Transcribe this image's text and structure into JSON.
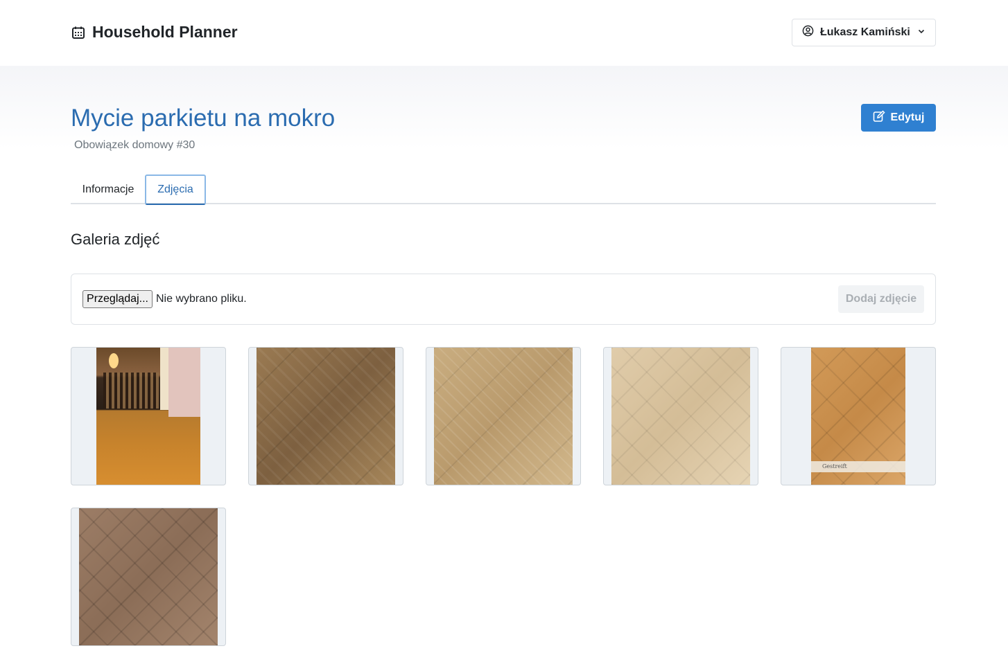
{
  "app": {
    "title": "Household Planner",
    "user_name": "Łukasz Kamiński"
  },
  "page": {
    "title": "Mycie parkietu na mokro",
    "subtitle": "Obowiązek domowy #30",
    "edit_label": "Edytuj"
  },
  "tabs": [
    {
      "label": "Informacje",
      "active": false
    },
    {
      "label": "Zdjęcia",
      "active": true
    }
  ],
  "gallery": {
    "title": "Galeria zdjęć",
    "browse_label": "Przeglądaj...",
    "no_file_text": "Nie wybrano pliku.",
    "add_label": "Dodaj zdjęcie",
    "photos": [
      {
        "caption": ""
      },
      {
        "caption": ""
      },
      {
        "caption": ""
      },
      {
        "caption": ""
      },
      {
        "caption": "Gestreift"
      },
      {
        "caption": ""
      }
    ]
  },
  "colors": {
    "accent": "#2f80d1",
    "title": "#2b6cb0"
  }
}
